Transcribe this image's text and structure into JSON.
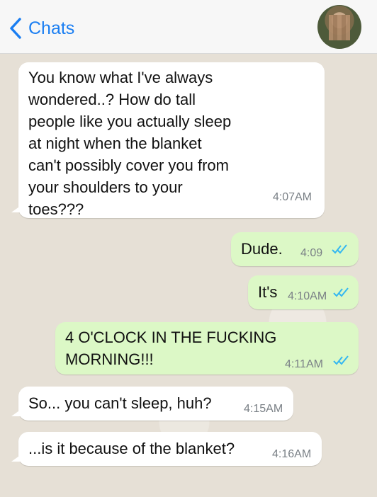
{
  "header": {
    "back_label": "Chats",
    "icons": [
      "chevron-left-icon",
      "contact-avatar"
    ]
  },
  "messages": [
    {
      "direction": "incoming",
      "lines": [
        "You know what I've always",
        "wondered..? How do tall",
        "people like you actually sleep",
        "at night when the blanket",
        "can't possibly cover you from",
        "your shoulders to your",
        "toes???"
      ],
      "time": "4:07AM"
    },
    {
      "direction": "outgoing",
      "text": "Dude.",
      "time": "4:09",
      "status": "read"
    },
    {
      "direction": "outgoing",
      "text": "It's",
      "time": "4:10AM",
      "status": "read"
    },
    {
      "direction": "outgoing",
      "lines": [
        "4 O'CLOCK IN THE FUCKING",
        "MORNING!!!"
      ],
      "time": "4:11AM",
      "status": "read"
    },
    {
      "direction": "incoming",
      "text": "So... you can't sleep, huh?",
      "time": "4:15AM"
    },
    {
      "direction": "incoming",
      "text": "...is it because of the blanket?",
      "time": "4:16AM"
    }
  ],
  "colors": {
    "accent": "#1a7ef2",
    "outgoing_bubble": "#dcf8c6",
    "incoming_bubble": "#ffffff",
    "read_check": "#34b7f1"
  }
}
